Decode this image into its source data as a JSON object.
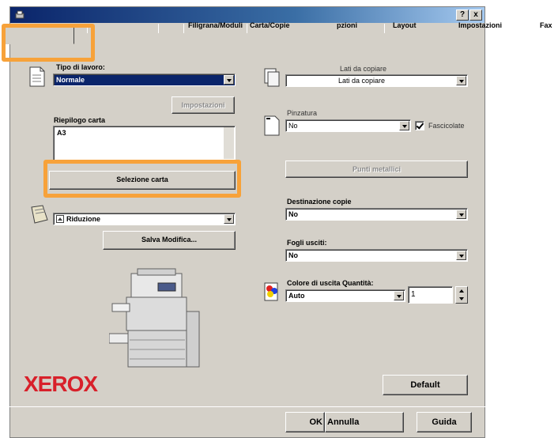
{
  "window": {
    "help_label": "?",
    "close_label": "x"
  },
  "tabs": [
    {
      "label": ""
    },
    {
      "label": ""
    },
    {
      "label": "Filigrana/Moduli"
    },
    {
      "label": "Carta/Copie"
    },
    {
      "label": "pzioni"
    },
    {
      "label": "Layout"
    },
    {
      "label": "Impostazioni"
    },
    {
      "label": "Fax"
    }
  ],
  "left": {
    "job_type_label": "Tipo di lavoro:",
    "job_type_value": "Normale",
    "settings_button": "Impostazioni",
    "paper_summary_label": "Riepilogo carta",
    "paper_summary_value": "A3",
    "paper_select_button": "Selezione carta",
    "reduction_value": "Riduzione",
    "save_changes_button": "Salva Modifica..."
  },
  "right": {
    "sides_label": "Lati da copiare",
    "sides_value": "Lati da copiare",
    "stapling_label": "Pinzatura",
    "stapling_value": "No",
    "collate_label": "Fascicolate",
    "staples_button": "Punti metallici",
    "destination_label": "Destinazione copie",
    "destination_value": "No",
    "output_sheets_label": "Fogli usciti:",
    "output_sheets_value": "No",
    "output_color_label": "Colore di uscita Quantità:",
    "output_color_value": "Auto",
    "quantity_value": "1",
    "default_button": "Default"
  },
  "footer": {
    "brand": "XEROX",
    "ok_button": "OK",
    "cancel_button": "Annulla",
    "help_button": "Guida"
  },
  "colors": {
    "highlight": "#f7a23a",
    "brand": "#d8202a",
    "titlebar": "#0a246a"
  }
}
